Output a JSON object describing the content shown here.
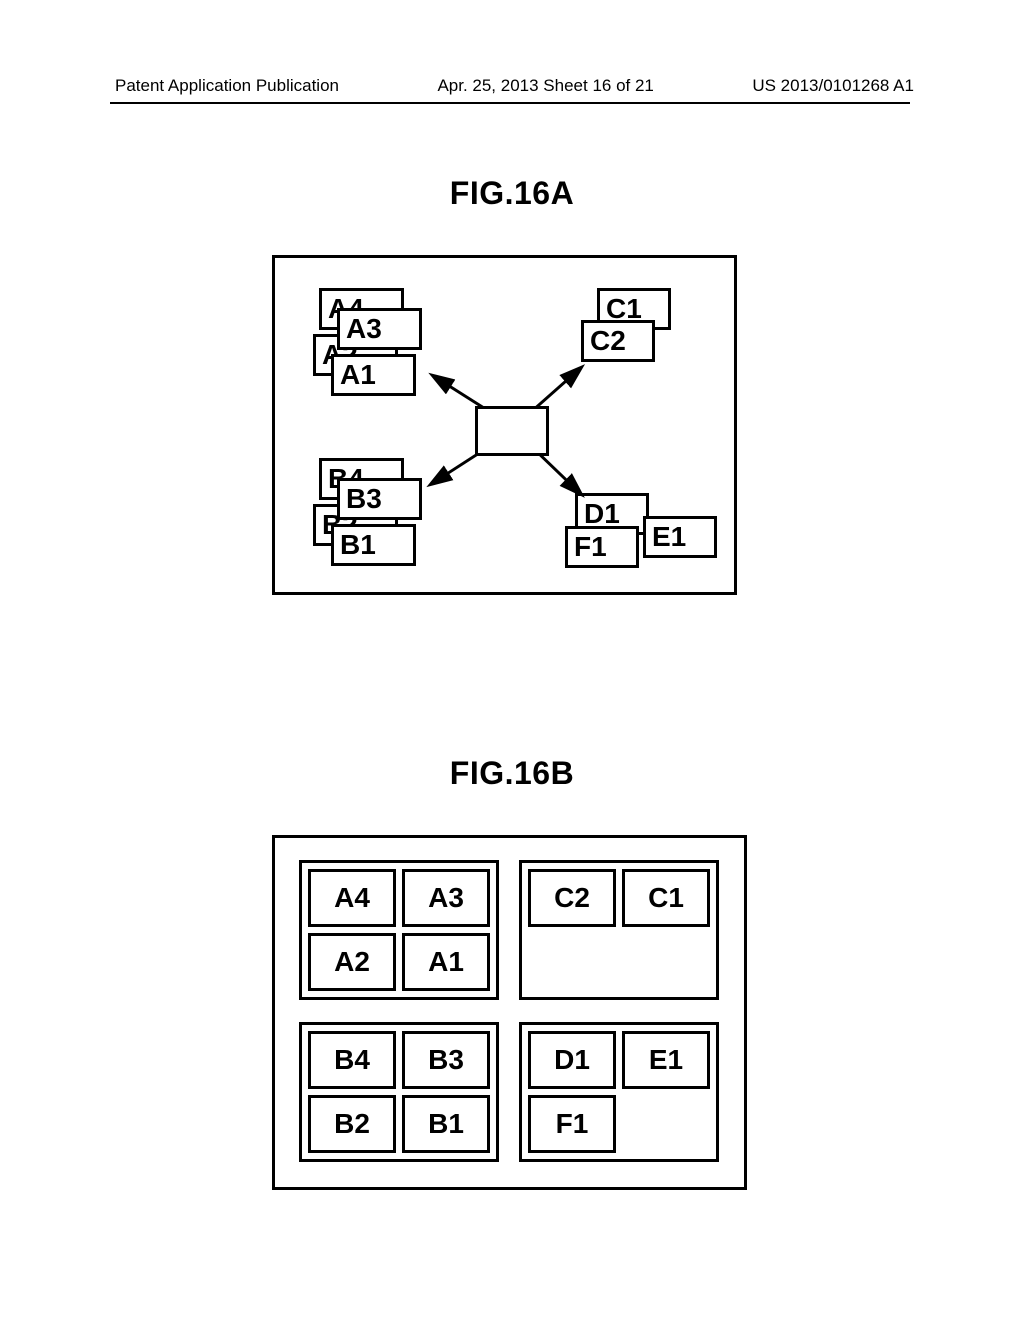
{
  "header": {
    "left": "Patent Application Publication",
    "center": "Apr. 25, 2013  Sheet 16 of 21",
    "right": "US 2013/0101268 A1"
  },
  "figures": {
    "a": {
      "title": "FIG.16A",
      "cluster_a": {
        "a4": "A4",
        "a3": "A3",
        "a2": "A2",
        "a1": "A1"
      },
      "cluster_b": {
        "b4": "B4",
        "b3": "B3",
        "b2": "B2",
        "b1": "B1"
      },
      "cluster_c": {
        "c1": "C1",
        "c2": "C2"
      },
      "cluster_def": {
        "d1": "D1",
        "e1": "E1",
        "f1": "F1"
      }
    },
    "b": {
      "title": "FIG.16B",
      "q_tl": [
        "A4",
        "A3",
        "A2",
        "A1"
      ],
      "q_tr": [
        "C2",
        "C1",
        "",
        ""
      ],
      "q_bl": [
        "B4",
        "B3",
        "B2",
        "B1"
      ],
      "q_br": [
        "D1",
        "E1",
        "F1",
        ""
      ]
    }
  }
}
